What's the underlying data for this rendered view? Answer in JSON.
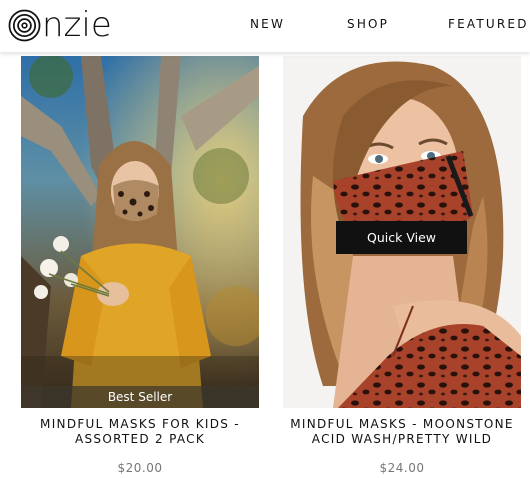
{
  "brand": {
    "logo_text": "nzie",
    "logo_icon": "concentric-circles-logo-icon"
  },
  "nav": {
    "items": [
      {
        "label": "NEW"
      },
      {
        "label": "SHOP"
      },
      {
        "label": "FEATURED"
      }
    ]
  },
  "products": [
    {
      "badge": "Best Seller",
      "title_line1": "MINDFUL MASKS FOR KIDS -",
      "title_line2": "ASSORTED 2 PACK",
      "price": "$20.00"
    },
    {
      "quick_view": "Quick View",
      "title_line1": "MINDFUL MASKS - MOONSTONE",
      "title_line2": "ACID WASH/PRETTY WILD",
      "price": "$24.00"
    }
  ]
}
